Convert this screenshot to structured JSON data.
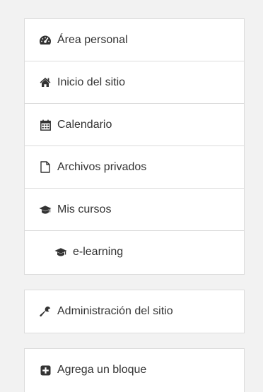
{
  "nav": {
    "items": [
      {
        "label": "Área personal",
        "icon": "dashboard-icon"
      },
      {
        "label": "Inicio del sitio",
        "icon": "home-icon"
      },
      {
        "label": "Calendario",
        "icon": "calendar-icon"
      },
      {
        "label": "Archivos privados",
        "icon": "file-icon"
      },
      {
        "label": "Mis cursos",
        "icon": "graduation-cap-icon"
      },
      {
        "label": "e-learning",
        "icon": "graduation-cap-icon"
      }
    ]
  },
  "admin": {
    "label": "Administración del sitio",
    "icon": "wrench-icon"
  },
  "block": {
    "label": "Agrega un bloque",
    "icon": "plus-square-icon"
  },
  "colors": {
    "text": "#333333",
    "border": "#dcdcdc",
    "background": "#f2f2f2",
    "panel": "#ffffff"
  }
}
